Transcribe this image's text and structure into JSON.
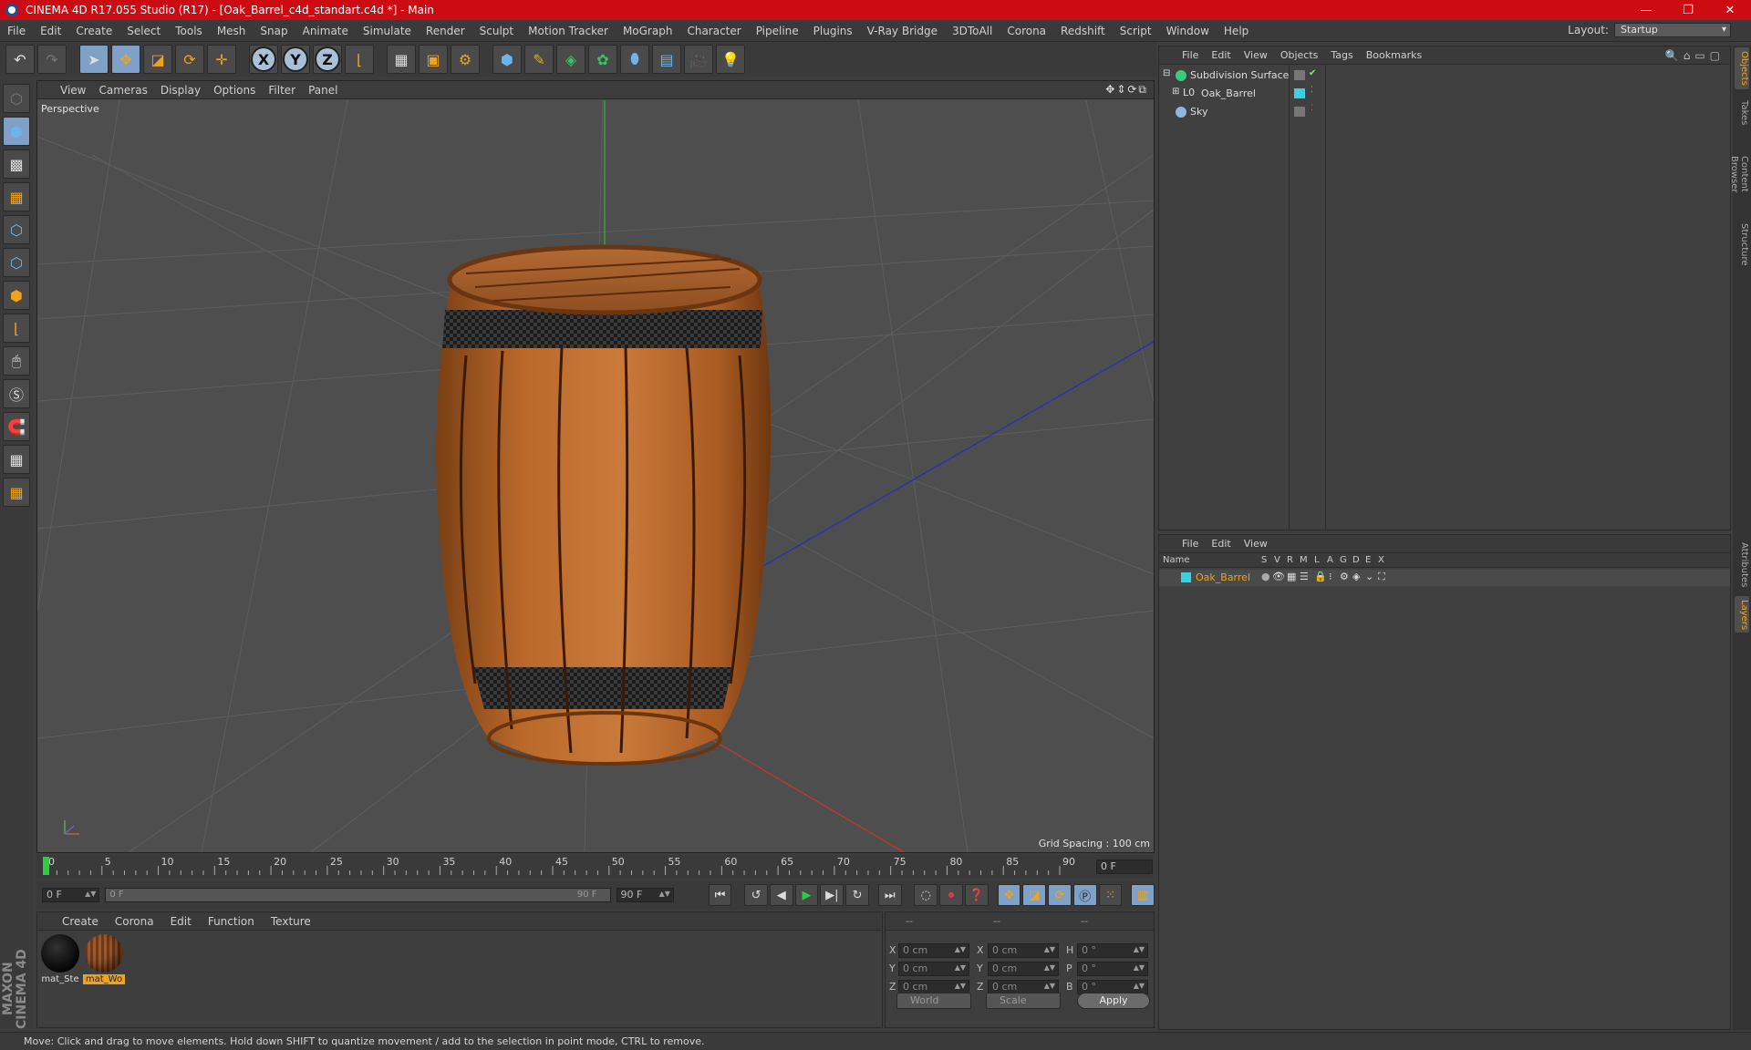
{
  "window": {
    "title": "CINEMA 4D R17.055 Studio (R17) - [Oak_Barrel_c4d_standart.c4d *] - Main",
    "minimize": "—",
    "restore": "❐",
    "close": "✕"
  },
  "menu": [
    "File",
    "Edit",
    "Create",
    "Select",
    "Tools",
    "Mesh",
    "Snap",
    "Animate",
    "Simulate",
    "Render",
    "Sculpt",
    "Motion Tracker",
    "MoGraph",
    "Character",
    "Pipeline",
    "Plugins",
    "V-Ray Bridge",
    "3DToAll",
    "Corona",
    "Redshift",
    "Script",
    "Window",
    "Help"
  ],
  "layout": {
    "label": "Layout:",
    "value": "Startup"
  },
  "viewport": {
    "menu": [
      "View",
      "Cameras",
      "Display",
      "Options",
      "Filter",
      "Panel"
    ],
    "label": "Perspective",
    "grid_spacing": "Grid Spacing : 100 cm",
    "nav_icons": "✥⇕⟳⧉"
  },
  "timeline": {
    "ticks": [
      "0",
      "5",
      "10",
      "15",
      "20",
      "25",
      "30",
      "35",
      "40",
      "45",
      "50",
      "55",
      "60",
      "65",
      "70",
      "75",
      "80",
      "85",
      "90"
    ],
    "current_frame": "0 F"
  },
  "transport": {
    "start": "0 F",
    "range_start": "0 F",
    "range_end": "90 F",
    "end": "90 F"
  },
  "materials": {
    "menu": [
      "Create",
      "Corona",
      "Edit",
      "Function",
      "Texture"
    ],
    "items": [
      {
        "name": "mat_Ste",
        "selected": false
      },
      {
        "name": "mat_Wo",
        "selected": true
      }
    ]
  },
  "coords": {
    "header": [
      "--",
      "--",
      "--"
    ],
    "rows": [
      {
        "a": "X",
        "av": "0 cm",
        "b": "X",
        "bv": "0 cm",
        "c": "H",
        "cv": "0 °"
      },
      {
        "a": "Y",
        "av": "0 cm",
        "b": "Y",
        "bv": "0 cm",
        "c": "P",
        "cv": "0 °"
      },
      {
        "a": "Z",
        "av": "0 cm",
        "b": "Z",
        "bv": "0 cm",
        "c": "B",
        "cv": "0 °"
      }
    ],
    "mode": "World",
    "scale": "Scale",
    "apply": "Apply"
  },
  "status": "Move: Click and drag to move elements. Hold down SHIFT to quantize movement / add to the selection in point mode, CTRL to remove.",
  "objects": {
    "menu": [
      "File",
      "Edit",
      "View",
      "Objects",
      "Tags",
      "Bookmarks"
    ],
    "items": [
      {
        "name": "Subdivision Surface",
        "icon_color": "#3ec97d"
      },
      {
        "name": "Oak_Barrel",
        "icon_color": "#cfcfcf"
      },
      {
        "name": "Sky",
        "icon_color": "#8fb8e0"
      }
    ]
  },
  "layers": {
    "menu": [
      "File",
      "Edit",
      "View"
    ],
    "columns": [
      "Name",
      "S",
      "V",
      "R",
      "M",
      "L",
      "A",
      "G",
      "D",
      "E",
      "X"
    ],
    "row_name": "Oak_Barrel",
    "row_color": "#3ecfe0"
  },
  "right_tabs_top": [
    "Objects",
    "Takes",
    "Content Browser",
    "Structure"
  ],
  "right_tabs_bottom": [
    "Attributes",
    "Layers"
  ],
  "brand": "MAXON CINEMA 4D",
  "colors": {
    "accent": "#f0a31a",
    "title_bar": "#cc0b12",
    "selected_tool": "#7fa0c7"
  }
}
